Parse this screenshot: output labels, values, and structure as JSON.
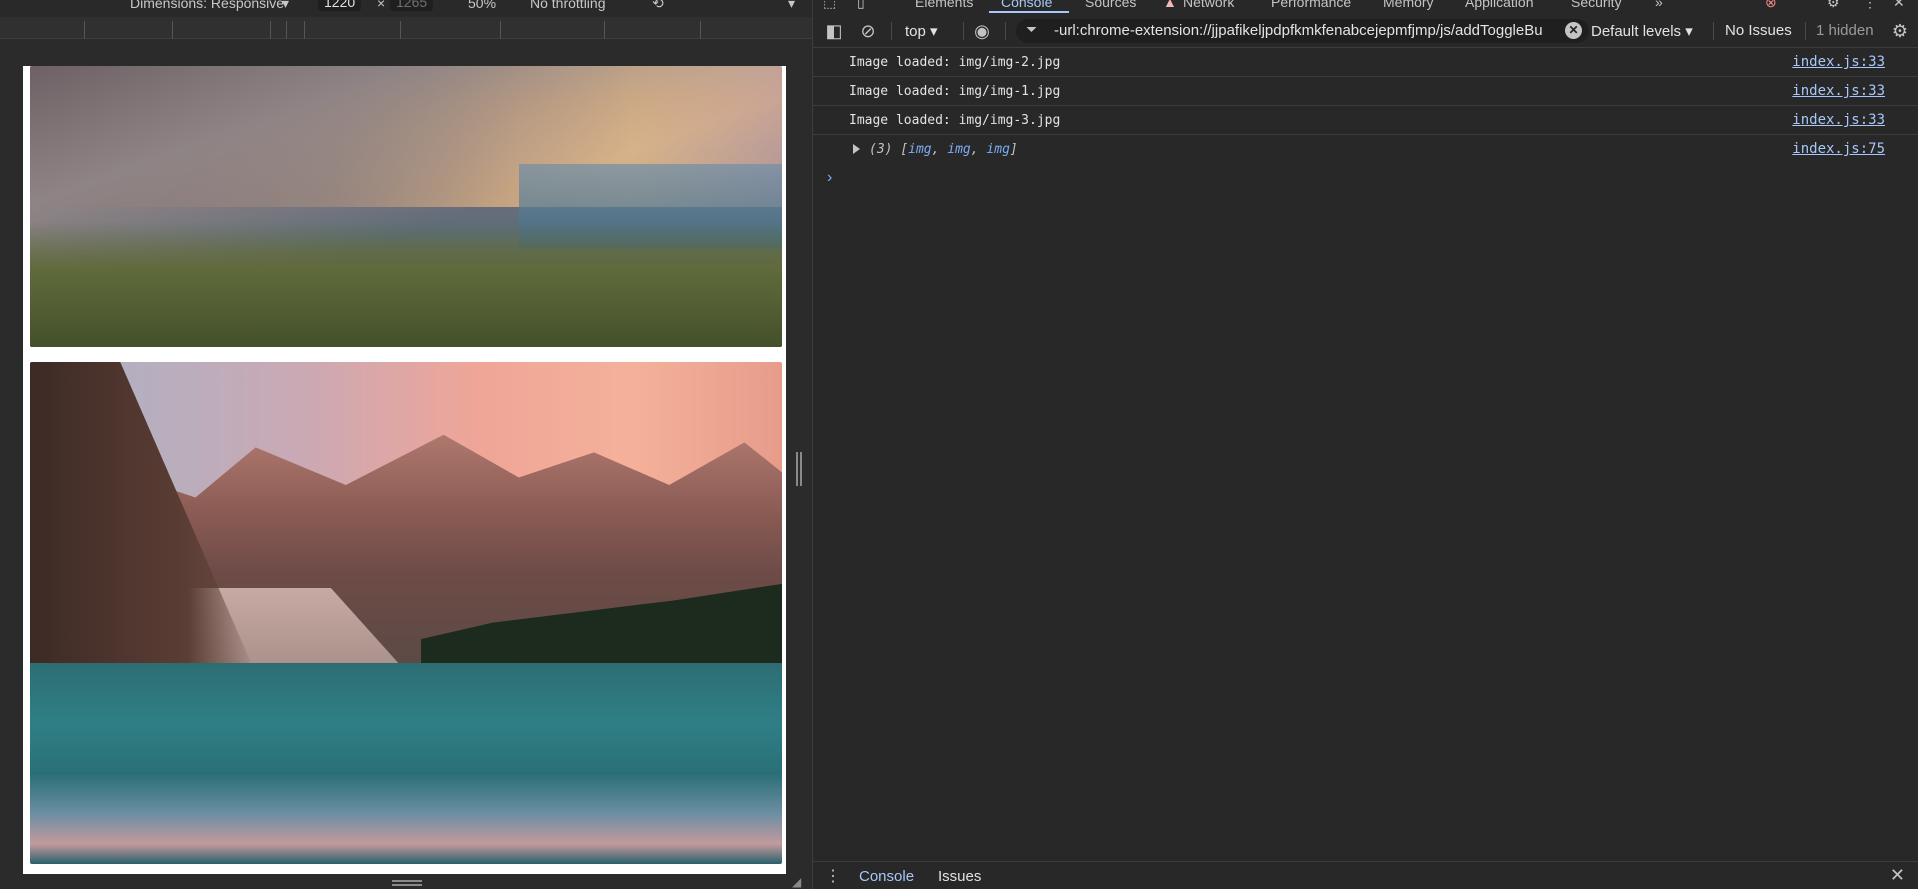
{
  "device_toolbar": {
    "dimensions_label": "Dimensions: Responsive",
    "width_value": "1220",
    "height_value": "1265",
    "times": "×",
    "zoom": "50%",
    "throttling": "No throttling"
  },
  "devtools": {
    "tabs": [
      {
        "label": "Elements"
      },
      {
        "label": "Console",
        "active": true
      },
      {
        "label": "Sources"
      },
      {
        "label": "Network"
      },
      {
        "label": "Performance"
      },
      {
        "label": "Memory"
      },
      {
        "label": "Application"
      },
      {
        "label": "Security"
      }
    ],
    "toolbar": {
      "context": "top",
      "filter_value": "-url:chrome-extension://jjpafikeljpdpfkmkfenabcejepmfjmp/js/addToggleBu",
      "levels": "Default levels",
      "issues": "No Issues",
      "hidden": "1 hidden"
    },
    "console": {
      "logs": [
        {
          "text": "Image loaded: img/img-2.jpg",
          "source": "index.js:33"
        },
        {
          "text": "Image loaded: img/img-1.jpg",
          "source": "index.js:33"
        },
        {
          "text": "Image loaded: img/img-3.jpg",
          "source": "index.js:33"
        }
      ],
      "array_log": {
        "count": "(3)",
        "open": "[",
        "items": [
          "img",
          "img",
          "img"
        ],
        "close": "]",
        "source": "index.js:75"
      },
      "prompt": "›"
    },
    "drawer": {
      "tabs": [
        {
          "label": "Console",
          "active": true
        },
        {
          "label": "Issues"
        }
      ]
    }
  }
}
